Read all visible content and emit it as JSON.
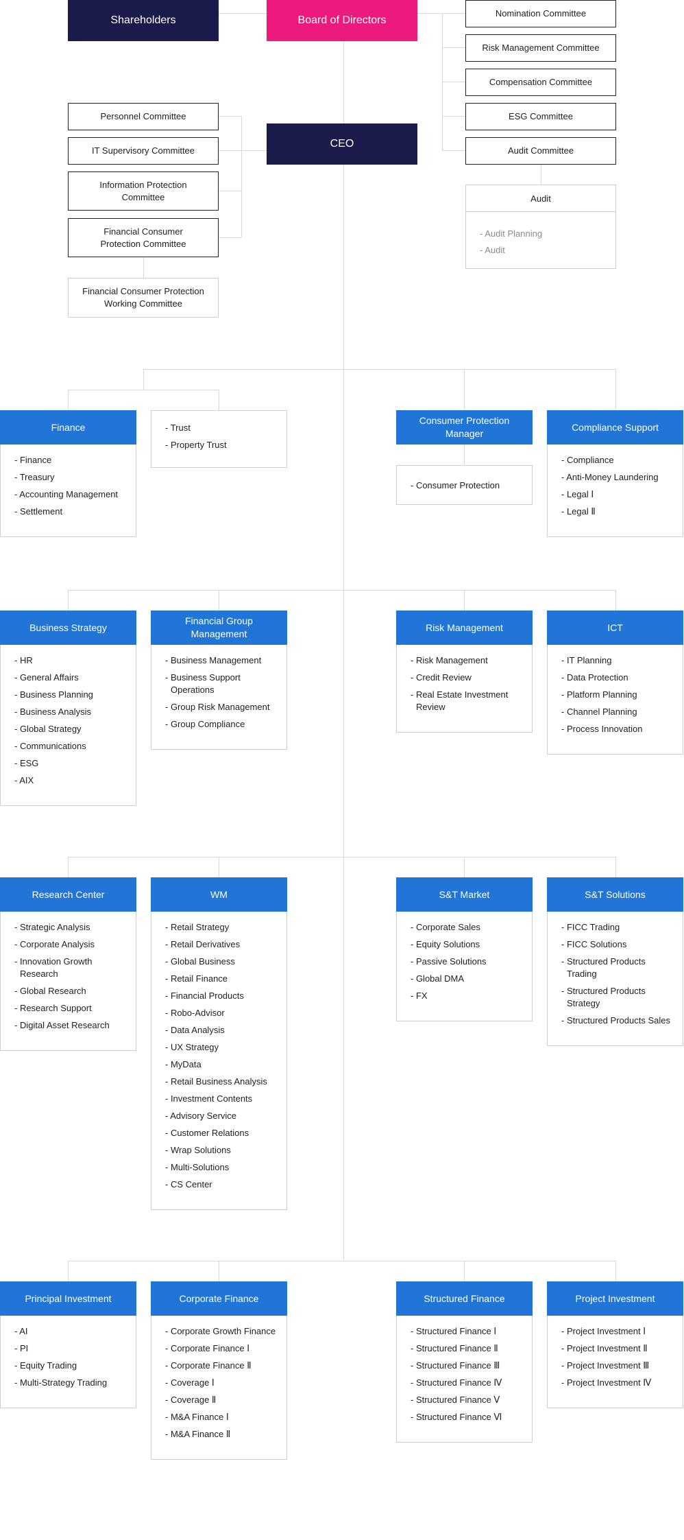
{
  "governance": {
    "shareholders": "Shareholders",
    "board": "Board of Directors",
    "ceo": "CEO",
    "colors": {
      "navy": "#1b1b4b",
      "pink": "#ec1a7c",
      "blue": "#2075d6"
    }
  },
  "board_committees": [
    "Nomination Committee",
    "Risk Management Committee",
    "Compensation Committee",
    "ESG Committee",
    "Audit Committee"
  ],
  "audit": {
    "title": "Audit",
    "items": [
      "- Audit Planning",
      "- Audit"
    ]
  },
  "ceo_committees": [
    "Personnel Committee",
    "IT Supervisory Committee",
    "Information Protection Committee",
    "Financial Consumer Protection Committee"
  ],
  "working_committee": "Financial Consumer Protection Working Committee",
  "rows": [
    {
      "departments": [
        {
          "title": "Finance",
          "items": [
            "- Finance",
            "- Treasury",
            "- Accounting Management",
            "- Settlement"
          ]
        },
        {
          "title": null,
          "items": [
            "- Trust",
            "- Property Trust"
          ]
        },
        {
          "title": "Consumer Protection Manager",
          "items": [
            "- Consumer Protection"
          ]
        },
        {
          "title": "Compliance Support",
          "items": [
            "- Compliance",
            "- Anti-Money Laundering",
            "- Legal Ⅰ",
            "- Legal Ⅱ"
          ]
        }
      ]
    },
    {
      "departments": [
        {
          "title": "Business Strategy",
          "items": [
            "- HR",
            "- General Affairs",
            "- Business Planning",
            "- Business Analysis",
            "- Global Strategy",
            "- Communications",
            "- ESG",
            "- AIX"
          ]
        },
        {
          "title": "Financial Group Management",
          "items": [
            "- Business Management",
            "- Business Support Operations",
            "- Group Risk Management",
            "- Group Compliance"
          ]
        },
        {
          "title": "Risk Management",
          "items": [
            "- Risk Management",
            "- Credit Review",
            "- Real Estate Investment Review"
          ]
        },
        {
          "title": "ICT",
          "items": [
            "- IT Planning",
            "- Data Protection",
            "- Platform Planning",
            "- Channel Planning",
            "- Process Innovation"
          ]
        }
      ]
    },
    {
      "departments": [
        {
          "title": "Research Center",
          "items": [
            "- Strategic Analysis",
            "- Corporate Analysis",
            "- Innovation Growth Research",
            "- Global Research",
            "- Research Support",
            "- Digital Asset Research"
          ]
        },
        {
          "title": "WM",
          "items": [
            "- Retail Strategy",
            "- Retail Derivatives",
            "- Global Business",
            "- Retail Finance",
            "- Financial Products",
            "- Robo-Advisor",
            "- Data Analysis",
            "- UX Strategy",
            "- MyData",
            "- Retail Business Analysis",
            "- Investment Contents",
            "- Advisory Service",
            "- Customer Relations",
            "- Wrap Solutions",
            "- Multi-Solutions",
            "- CS Center"
          ]
        },
        {
          "title": "S&T Market",
          "items": [
            "- Corporate Sales",
            "- Equity Solutions",
            "- Passive Solutions",
            "- Global DMA",
            "- FX"
          ]
        },
        {
          "title": "S&T Solutions",
          "items": [
            "- FICC Trading",
            "- FICC Solutions",
            "- Structured Products Trading",
            "- Structured Products Strategy",
            "- Structured Products Sales"
          ]
        }
      ]
    },
    {
      "departments": [
        {
          "title": "Principal Investment",
          "items": [
            "- AI",
            "- PI",
            "- Equity Trading",
            "- Multi-Strategy Trading"
          ]
        },
        {
          "title": "Corporate Finance",
          "items": [
            "- Corporate Growth Finance",
            "- Corporate Finance Ⅰ",
            "- Corporate Finance Ⅱ",
            "- Coverage Ⅰ",
            "- Coverage Ⅱ",
            "- M&A Finance Ⅰ",
            "- M&A Finance Ⅱ"
          ]
        },
        {
          "title": "Structured Finance",
          "items": [
            "- Structured Finance Ⅰ",
            "- Structured Finance Ⅱ",
            "- Structured Finance Ⅲ",
            "- Structured Finance Ⅳ",
            "- Structured Finance Ⅴ",
            "- Structured Finance Ⅵ"
          ]
        },
        {
          "title": "Project Investment",
          "items": [
            "- Project Investment Ⅰ",
            "- Project Investment Ⅱ",
            "- Project Investment Ⅲ",
            "- Project Investment Ⅳ"
          ]
        }
      ]
    }
  ]
}
